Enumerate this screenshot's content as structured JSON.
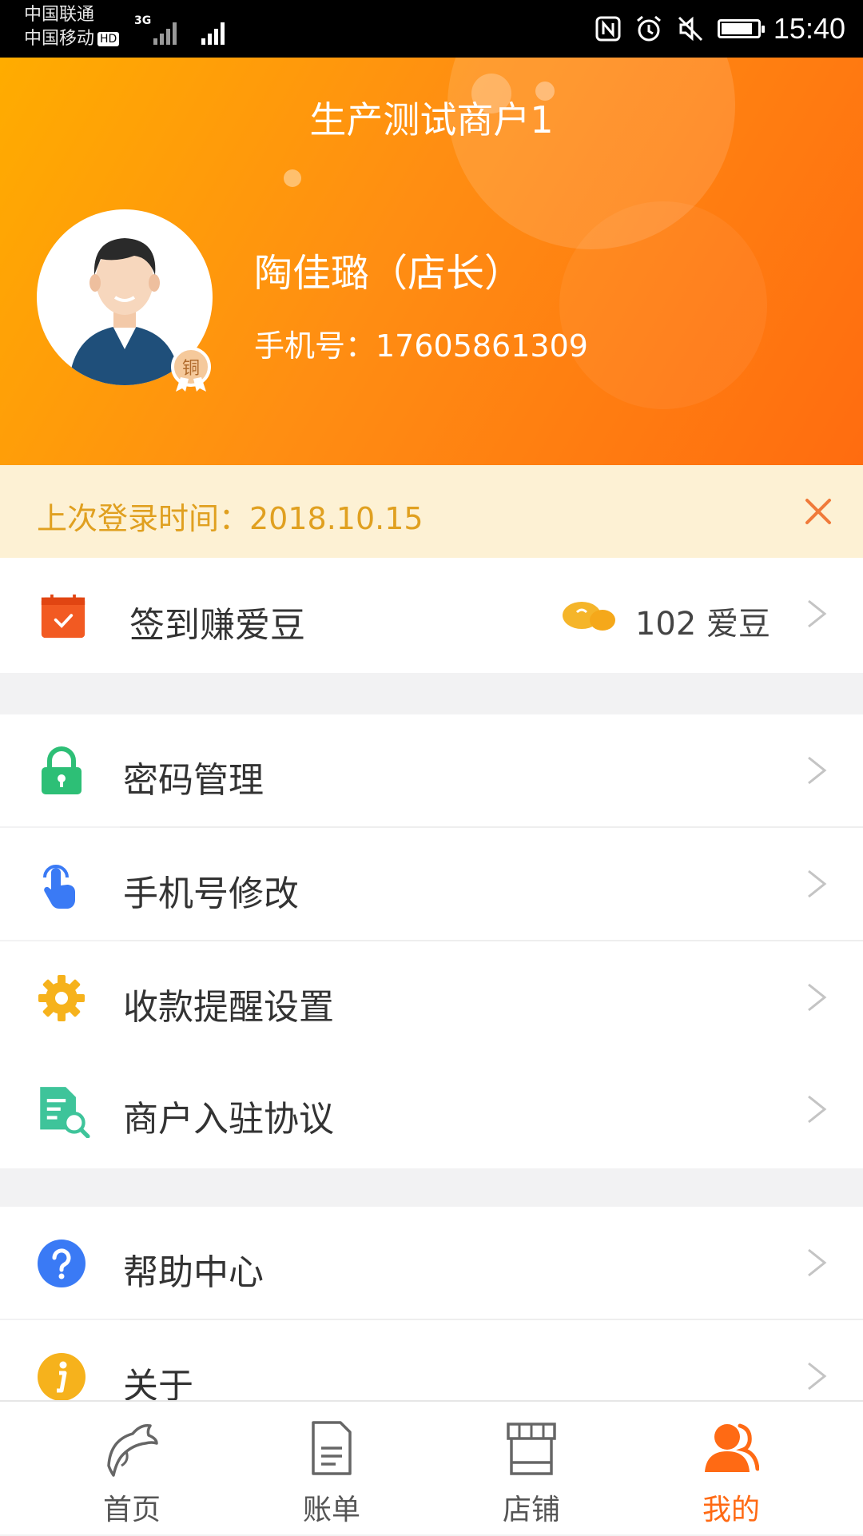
{
  "status_bar": {
    "carrier_1": "中国联通",
    "carrier_2": "中国移动",
    "network_1": "3G",
    "hd_label": "HD",
    "time": "15:40"
  },
  "header": {
    "title": "生产测试商户1",
    "user_name": "陶佳璐（店长）",
    "phone": "手机号：17605861309",
    "badge_text": "铜"
  },
  "notice": {
    "text": "上次登录时间：2018.10.15"
  },
  "signin": {
    "label": "签到赚爱豆",
    "beans": "102 爱豆"
  },
  "menu_group_1": [
    {
      "label": "密码管理",
      "icon": "lock-icon"
    },
    {
      "label": "手机号修改",
      "icon": "touch-hand-icon"
    },
    {
      "label": "收款提醒设置",
      "icon": "gear-icon"
    },
    {
      "label": "商户入驻协议",
      "icon": "document-search-icon"
    }
  ],
  "menu_group_2": [
    {
      "label": "帮助中心",
      "icon": "question-icon"
    },
    {
      "label": "关于",
      "icon": "info-icon"
    }
  ],
  "tabs": [
    {
      "label": "首页",
      "icon": "dolphin-icon"
    },
    {
      "label": "账单",
      "icon": "bill-icon"
    },
    {
      "label": "店铺",
      "icon": "store-icon"
    },
    {
      "label": "我的",
      "icon": "users-icon",
      "active": true
    }
  ],
  "colors": {
    "accent": "#ff6a14",
    "header_start": "#ffac00",
    "header_end": "#ff6c10",
    "notice_bg": "#fdf1d4",
    "notice_text": "#e0a020"
  }
}
